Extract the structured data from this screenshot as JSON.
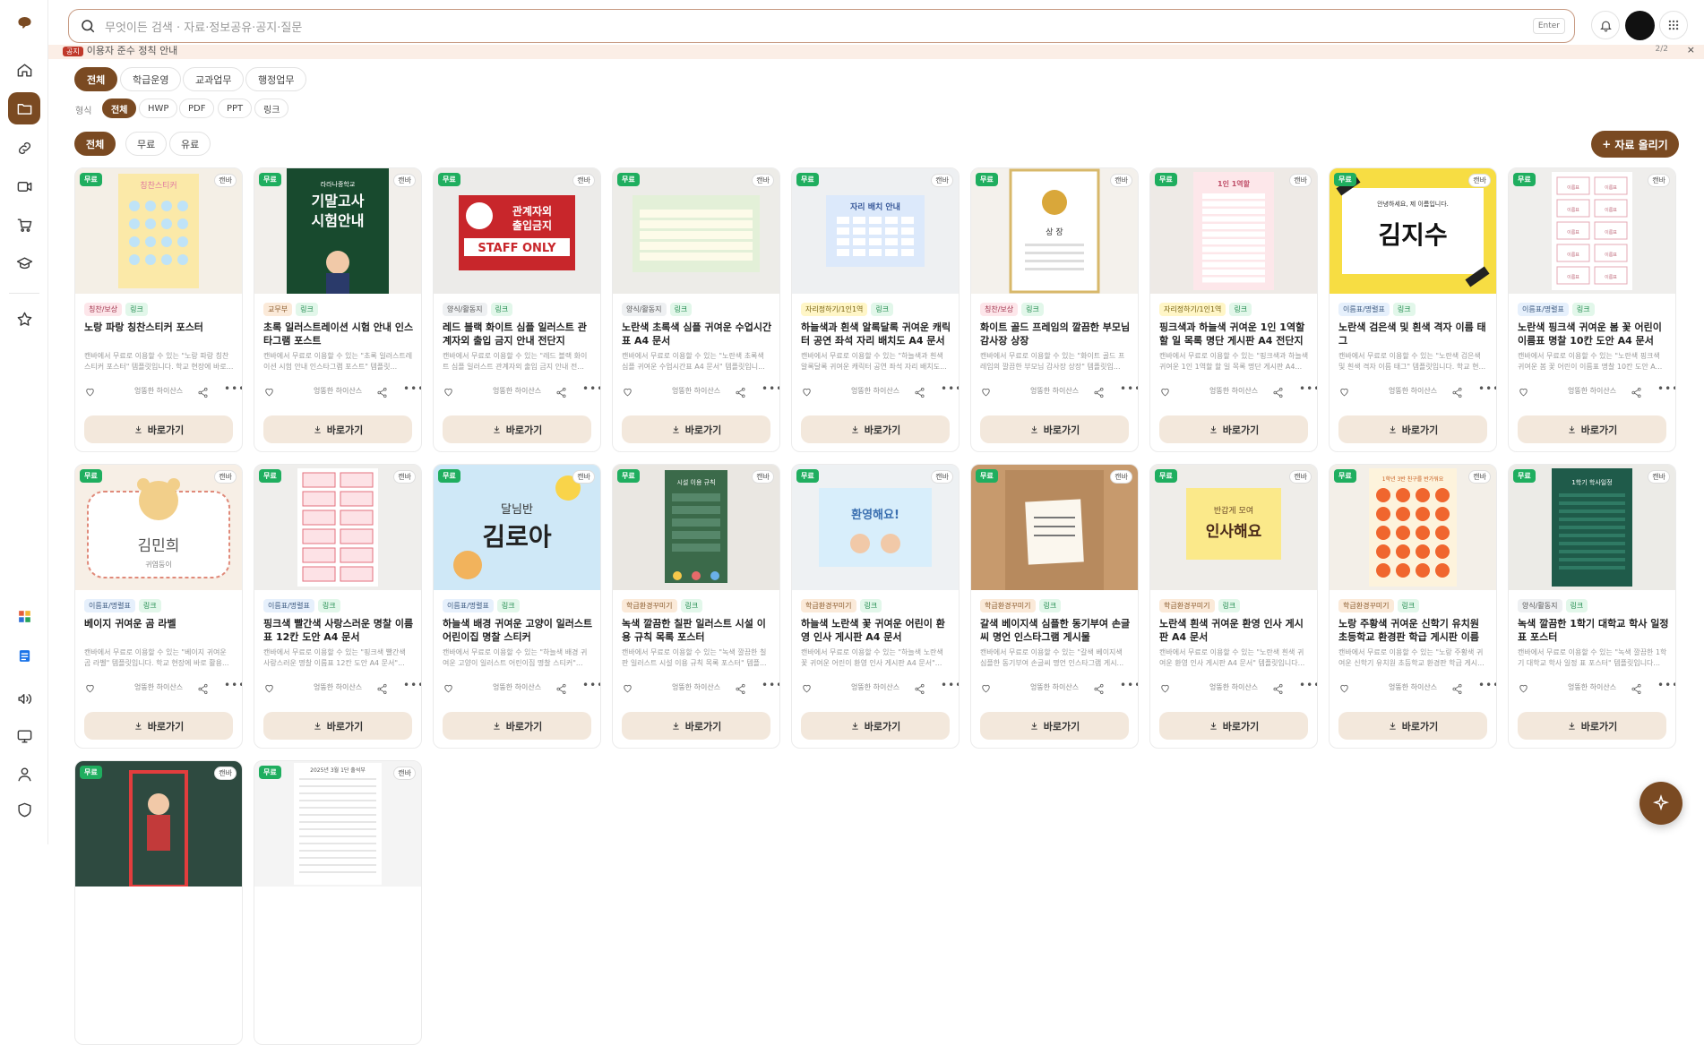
{
  "search": {
    "placeholder": "무엇이든 검색 · 자료·정보공유·공지·질문",
    "enter_label": "Enter"
  },
  "notice": {
    "tag": "공지",
    "text": "이용자 준수 정칙 안내",
    "page": "2/2"
  },
  "categories": [
    "전체",
    "학급운영",
    "교과업무",
    "행정업무"
  ],
  "format_label": "형식",
  "formats": [
    "전체",
    "HWP",
    "PDF",
    "PPT",
    "링크"
  ],
  "prices": [
    "전체",
    "무료",
    "유료"
  ],
  "upload_label": "자료 올리기",
  "colors": {
    "accent": "#7a4a22",
    "free_badge": "#1fae5f",
    "button_bg": "#f3e8dc"
  },
  "card_labels": {
    "free": "무료",
    "premium": "캔바",
    "download": "바로가기",
    "link_tag": "링크"
  },
  "cards": [
    {
      "category": "칭찬/보상",
      "tag_style": "p",
      "title": "노랑 파랑 칭찬스티커 포스터",
      "desc": "캔바에서 무료로 이용할 수 있는 \"노랑 파랑 칭찬스티커 포스터\" 템플릿입니다. 학교 현장에 바로...",
      "author": "엉뚱한 하이산스"
    },
    {
      "category": "교무부",
      "tag_style": "",
      "title": "초록 일러스트레이션 시험 안내 인스타그램 포스트",
      "desc": "캔바에서 무료로 이용할 수 있는 \"초록 일러스트레이션 시험 안내 인스타그램 포스트\" 템플릿...",
      "author": "엉뚱한 하이산스"
    },
    {
      "category": "양식/활동지",
      "tag_style": "g",
      "title": "레드 블랙 화이트 심플 일러스트 관계자외 출입 금지 안내 전단지",
      "desc": "캔바에서 무료로 이용할 수 있는 \"레드 블랙 화이트 심플 일러스트 관계자외 출입 금지 안내 전...",
      "author": "엉뚱한 하이산스"
    },
    {
      "category": "양식/활동지",
      "tag_style": "g",
      "title": "노란색 초록색 심플 귀여운 수업시간표 A4 문서",
      "desc": "캔바에서 무료로 이용할 수 있는 \"노란색 초록색 심플 귀여운 수업시간표 A4 문서\" 템플릿입니...",
      "author": "엉뚱한 하이산스"
    },
    {
      "category": "자리정하기/1인1역",
      "tag_style": "y",
      "title": "하늘색과 흰색 알록달록 귀여운 캐릭터 공연 좌석 자리 배치도 A4 문서",
      "desc": "캔바에서 무료로 이용할 수 있는 \"하늘색과 흰색 알록달록 귀여운 캐릭터 공연 좌석 자리 배치도...",
      "author": "엉뚱한 하이산스"
    },
    {
      "category": "칭찬/보상",
      "tag_style": "p",
      "title": "화이트 골드 프레임의 깔끔한 부모님 감사장 상장",
      "desc": "캔바에서 무료로 이용할 수 있는 \"화이트 골드 프레임의 깔끔한 부모님 감사장 상장\" 템플릿입...",
      "author": "엉뚱한 하이산스"
    },
    {
      "category": "자리정하기/1인1역",
      "tag_style": "y",
      "title": "핑크색과 하늘색 귀여운 1인 1역할 할 일 목록 명단 게시판 A4 전단지",
      "desc": "캔바에서 무료로 이용할 수 있는 \"핑크색과 하늘색 귀여운 1인 1역할 할 일 목록 명단 게시판 A4...",
      "author": "엉뚱한 하이산스"
    },
    {
      "category": "이름표/명렬표",
      "tag_style": "b",
      "title": "노란색 검은색 및 흰색 격자 이름 태그",
      "desc": "캔바에서 무료로 이용할 수 있는 \"노란색 검은색 및 흰색 격자 이름 태그\" 템플릿입니다. 학교 현...",
      "author": "엉뚱한 하이산스"
    },
    {
      "category": "이름표/명렬표",
      "tag_style": "b",
      "title": "노란색 핑크색 귀여운 봄 꽃 어린이 이름표 명찰 10칸 도안 A4 문서",
      "desc": "캔바에서 무료로 이용할 수 있는 \"노란색 핑크색 귀여운 봄 꽃 어린이 이름표 명찰 10칸 도안 A...",
      "author": "엉뚱한 하이산스"
    },
    {
      "category": "이름표/명렬표",
      "tag_style": "b",
      "title": "베이지 귀여운 곰 라벨",
      "desc": "캔바에서 무료로 이용할 수 있는 \"베이지 귀여운 곰 라벨\" 템플릿입니다. 학교 현장에 바로 활용...",
      "author": "엉뚱한 하이산스"
    },
    {
      "category": "이름표/명렬표",
      "tag_style": "b",
      "title": "핑크색 빨간색 사랑스러운 명찰 이름표 12칸 도안 A4 문서",
      "desc": "캔바에서 무료로 이용할 수 있는 \"핑크색 빨간색 사랑스러운 명찰 이름표 12칸 도안 A4 문서\"...",
      "author": "엉뚱한 하이산스"
    },
    {
      "category": "이름표/명렬표",
      "tag_style": "b",
      "title": "하늘색 배경 귀여운 고양이 일러스트 어린이집 명찰 스티커",
      "desc": "캔바에서 무료로 이용할 수 있는 \"하늘색 배경 귀여운 고양이 일러스트 어린이집 명찰 스티커\"...",
      "author": "엉뚱한 하이산스"
    },
    {
      "category": "학급환경꾸미기",
      "tag_style": "",
      "title": "녹색 깔끔한 칠판 일러스트 시설 이용 규칙 목록 포스터",
      "desc": "캔바에서 무료로 이용할 수 있는 \"녹색 깔끔한 칠판 일러스트 시설 이용 규칙 목록 포스터\" 템플...",
      "author": "엉뚱한 하이산스"
    },
    {
      "category": "학급환경꾸미기",
      "tag_style": "",
      "title": "하늘색 노란색 꽃 귀여운 어린이 환영 인사 게시판 A4 문서",
      "desc": "캔바에서 무료로 이용할 수 있는 \"하늘색 노란색 꽃 귀여운 어린이 환영 인사 게시판 A4 문서\"...",
      "author": "엉뚱한 하이산스"
    },
    {
      "category": "학급환경꾸미기",
      "tag_style": "",
      "title": "갈색 베이지색 심플한 동기부여 손글씨 명언 인스타그램 게시물",
      "desc": "캔바에서 무료로 이용할 수 있는 \"갈색 베이지색 심플한 동기부여 손글씨 명언 인스타그램 게시...",
      "author": "엉뚱한 하이산스"
    },
    {
      "category": "학급환경꾸미기",
      "tag_style": "",
      "title": "노란색 흰색 귀여운 환영 인사 게시판 A4 문서",
      "desc": "캔바에서 무료로 이용할 수 있는 \"노란색 흰색 귀여운 환영 인사 게시판 A4 문서\" 템플릿입니다...",
      "author": "엉뚱한 하이산스"
    },
    {
      "category": "학급환경꾸미기",
      "tag_style": "",
      "title": "노랑 주황색 귀여운 신학기 유치원 초등학교 환경판 학급 게시판 이름표...",
      "desc": "캔바에서 무료로 이용할 수 있는 \"노랑 주황색 귀여운 신학기 유치원 초등학교 환경판 학급 게시...",
      "author": "엉뚱한 하이산스"
    },
    {
      "category": "양식/활동지",
      "tag_style": "g",
      "title": "녹색 깔끔한 1학기 대학교 학사 일정 표 포스터",
      "desc": "캔바에서 무료로 이용할 수 있는 \"녹색 깔끔한 1학기 대학교 학사 일정 표 포스터\" 템플릿입니다...",
      "author": "엉뚱한 하이산스"
    },
    {
      "category": "",
      "tag_style": "",
      "title": "",
      "desc": "",
      "author": ""
    },
    {
      "category": "",
      "tag_style": "",
      "title": "",
      "desc": "",
      "author": ""
    }
  ],
  "thumb_texts": {
    "c1": "칭찬스티커",
    "c2_a": "라라나중학교",
    "c2_b": "기말고사",
    "c2_c": "시험안내",
    "c3_a": "관계자외",
    "c3_b": "출입금지",
    "c3_c": "STAFF ONLY",
    "c5": "자리 배치 안내",
    "c6": "상 장",
    "c7": "1인 1역할",
    "c8_a": "안녕하세요, 제 이름입니다.",
    "c8_b": "김지수",
    "c9": "이름표",
    "c10_a": "김민희",
    "c10_b": "귀염둥이",
    "c12_a": "달님반",
    "c12_b": "김로아",
    "c13": "시설 이용 규칙",
    "c14": "환영해요!",
    "c16_a": "반갑게 모여",
    "c16_b": "인사해요",
    "c17": "1학년 3반 친구를 반가워요",
    "c18": "1학기 학사일정",
    "c20": "2025년 3월 1단 출석부"
  }
}
